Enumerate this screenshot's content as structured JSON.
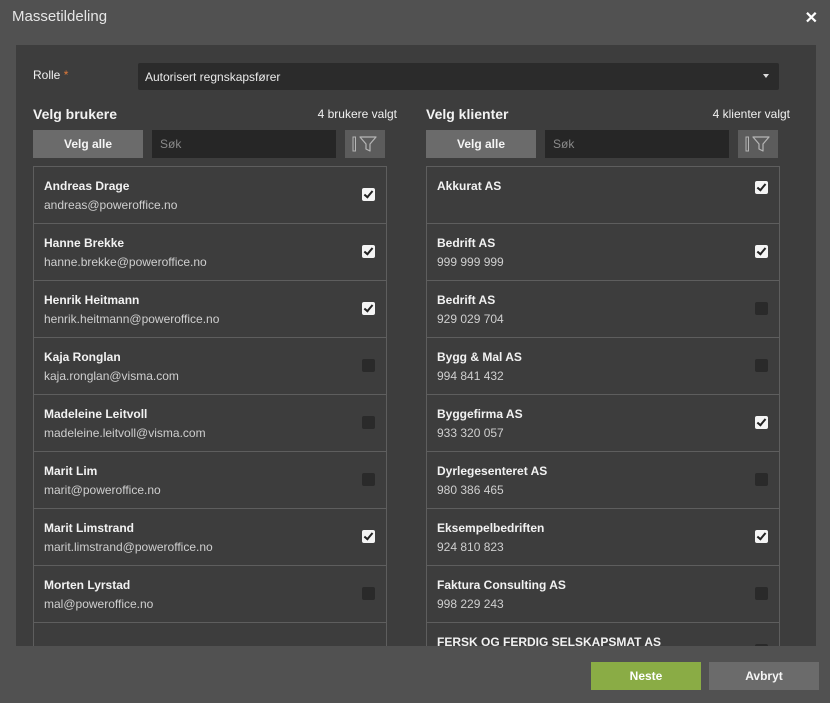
{
  "dialog": {
    "title": "Massetildeling",
    "close_symbol": "✕"
  },
  "role": {
    "label": "Rolle",
    "required_mark": "*",
    "value": "Autorisert regnskapsfører"
  },
  "users": {
    "title": "Velg brukere",
    "count_text": "4 brukere valgt",
    "select_all_label": "Velg alle",
    "search_placeholder": "Søk",
    "items": [
      {
        "name": "Andreas Drage",
        "sub": "andreas@poweroffice.no",
        "checked": true
      },
      {
        "name": "Hanne Brekke",
        "sub": "hanne.brekke@poweroffice.no",
        "checked": true
      },
      {
        "name": "Henrik Heitmann",
        "sub": "henrik.heitmann@poweroffice.no",
        "checked": true
      },
      {
        "name": "Kaja Ronglan",
        "sub": "kaja.ronglan@visma.com",
        "checked": false
      },
      {
        "name": "Madeleine Leitvoll",
        "sub": "madeleine.leitvoll@visma.com",
        "checked": false
      },
      {
        "name": "Marit Lim",
        "sub": "marit@poweroffice.no",
        "checked": false
      },
      {
        "name": "Marit Limstrand",
        "sub": "marit.limstrand@poweroffice.no",
        "checked": true
      },
      {
        "name": "Morten Lyrstad",
        "sub": "mal@poweroffice.no",
        "checked": false
      }
    ]
  },
  "clients": {
    "title": "Velg klienter",
    "count_text": "4 klienter valgt",
    "select_all_label": "Velg alle",
    "search_placeholder": "Søk",
    "items": [
      {
        "name": "Akkurat AS",
        "sub": "",
        "checked": true
      },
      {
        "name": "Bedrift AS",
        "sub": "999 999 999",
        "checked": true
      },
      {
        "name": "Bedrift AS",
        "sub": "929 029 704",
        "checked": false
      },
      {
        "name": "Bygg & Mal AS",
        "sub": "994 841 432",
        "checked": false
      },
      {
        "name": "Byggefirma AS",
        "sub": "933 320 057",
        "checked": true
      },
      {
        "name": "Dyrlegesenteret AS",
        "sub": "980 386 465",
        "checked": false
      },
      {
        "name": "Eksempelbedriften",
        "sub": "924 810 823",
        "checked": true
      },
      {
        "name": "Faktura Consulting AS",
        "sub": "998 229 243",
        "checked": false
      },
      {
        "name": "FERSK OG FERDIG SELSKAPSMAT AS",
        "sub": "",
        "checked": false
      }
    ]
  },
  "footer": {
    "next_label": "Neste",
    "cancel_label": "Avbryt"
  },
  "colors": {
    "accent_green": "#8aac45",
    "panel_bg": "#3d3d3d",
    "dialog_bg": "#515151"
  },
  "icons": {
    "filter": "filter-icon",
    "close": "close-icon",
    "dropdown": "chevron-down-icon",
    "checkbox": "checkbox"
  }
}
